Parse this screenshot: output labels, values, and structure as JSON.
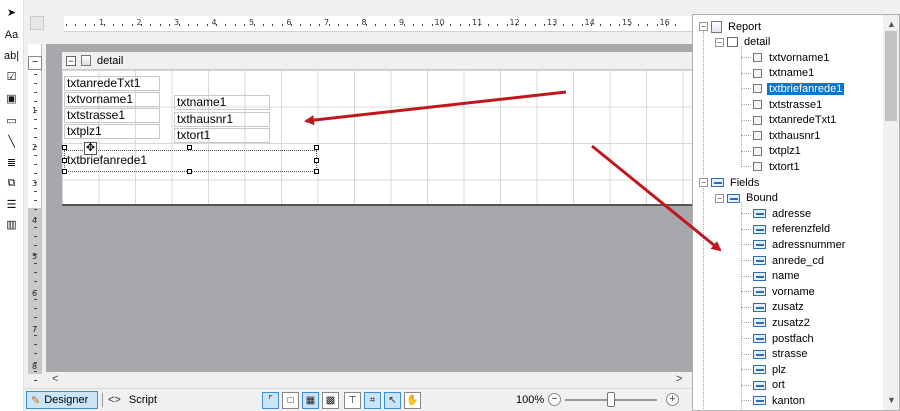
{
  "toolbox": {
    "items": [
      {
        "name": "pointer-tool-icon",
        "glyph": "➤"
      },
      {
        "name": "label-tool-icon",
        "glyph": "Aa"
      },
      {
        "name": "textbox-tool-icon",
        "glyph": "ab|"
      },
      {
        "name": "checkbox-tool-icon",
        "glyph": "☑"
      },
      {
        "name": "picture-tool-icon",
        "glyph": "▣"
      },
      {
        "name": "rectangle-tool-icon",
        "glyph": "▭"
      },
      {
        "name": "line-tool-icon",
        "glyph": "╲"
      },
      {
        "name": "richtext-tool-icon",
        "glyph": "≣"
      },
      {
        "name": "subreport-tool-icon",
        "glyph": "⧉"
      },
      {
        "name": "table-tool-icon",
        "glyph": "☰"
      },
      {
        "name": "barcode-tool-icon",
        "glyph": "▥"
      }
    ]
  },
  "ruler": {
    "numbers": [
      "1",
      "2",
      "3",
      "4",
      "5",
      "6",
      "7",
      "8",
      "9",
      "10",
      "11",
      "12",
      "13",
      "14",
      "15",
      "16"
    ],
    "vnumbers": [
      "1",
      "2",
      "3",
      "4",
      "5",
      "6",
      "7",
      "8"
    ]
  },
  "band": {
    "label": "detail",
    "collapse": "−"
  },
  "fields": [
    {
      "text": "txtanredeTxt1"
    },
    {
      "text": "txtvorname1"
    },
    {
      "text": "txtname1"
    },
    {
      "text": "txtstrasse1"
    },
    {
      "text": "txthausnr1"
    },
    {
      "text": "txtplz1"
    },
    {
      "text": "txtort1"
    },
    {
      "text": "txtbriefanrede1"
    }
  ],
  "statusbar": {
    "designer_label": "Designer",
    "script_code": "<>",
    "script_label": "Script",
    "zoom_label": "100%",
    "zoom_level": 0.5,
    "buttons": [
      {
        "name": "snap-lines-button",
        "glyph": "⌜",
        "active": true
      },
      {
        "name": "snap-grid-button",
        "glyph": "□",
        "active": false
      },
      {
        "name": "show-grid-button",
        "glyph": "▦",
        "active": true
      },
      {
        "name": "grid-button",
        "glyph": "▩",
        "active": false
      },
      {
        "name": "snap-ruler-button",
        "glyph": "⊤",
        "active": false
      },
      {
        "name": "dimension-lines-button",
        "glyph": "⌗",
        "active": true
      },
      {
        "name": "select-mode-button",
        "glyph": "↖",
        "active": true
      },
      {
        "name": "hand-tool-button",
        "glyph": "✋",
        "active": false
      }
    ]
  },
  "tree": {
    "report_label": "Report",
    "detail_label": "detail",
    "detail_items": [
      "txtvorname1",
      "txtname1",
      "txtbriefanrede1",
      "txtstrasse1",
      "txtanredeTxt1",
      "txthausnr1",
      "txtplz1",
      "txtort1"
    ],
    "selected_item": "txtbriefanrede1",
    "fields_label": "Fields",
    "bound_label": "Bound",
    "bound_items": [
      "adresse",
      "referenzfeld",
      "adressnummer",
      "anrede_cd",
      "name",
      "vorname",
      "zusatz",
      "zusatz2",
      "postfach",
      "strasse",
      "plz",
      "ort",
      "kanton"
    ]
  },
  "colors": {
    "annotation_arrow": "#c0161c",
    "selection": "#0078d7"
  }
}
